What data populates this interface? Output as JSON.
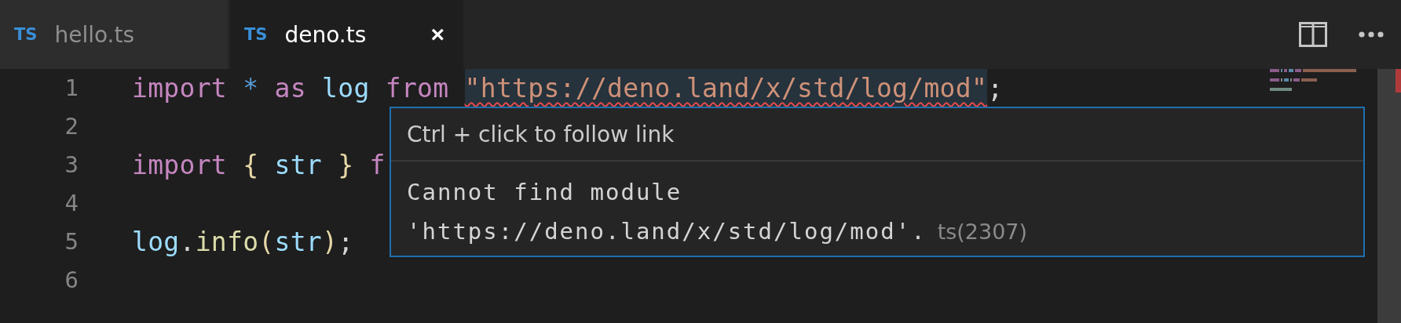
{
  "tabs": [
    {
      "icon": "TS",
      "label": "hello.ts",
      "selected": false
    },
    {
      "icon": "TS",
      "label": "deno.ts",
      "selected": true,
      "close": "×"
    }
  ],
  "editor": {
    "lines": [
      {
        "number": "1",
        "tokens": [
          {
            "kind": "keyword",
            "text": "import",
            "space": true
          },
          {
            "kind": "operator",
            "text": "*",
            "space": true
          },
          {
            "kind": "keyword",
            "text": "as",
            "space": true
          },
          {
            "kind": "variable",
            "text": "log",
            "space": true
          },
          {
            "kind": "keyword",
            "text": "from",
            "space": true
          },
          {
            "kind": "string",
            "text": "\"https://deno.land/x/std/log/mod\"",
            "highlighted": true,
            "error": true
          },
          {
            "kind": "punct",
            "text": ";"
          }
        ]
      },
      {
        "number": "2"
      },
      {
        "number": "3",
        "tokens": [
          {
            "kind": "keyword",
            "text": "import",
            "space": true
          },
          {
            "kind": "bracket",
            "text": "{",
            "space": true
          },
          {
            "kind": "variable",
            "text": "str",
            "space": true
          },
          {
            "kind": "bracket",
            "text": "}",
            "space": true
          },
          {
            "kind": "keyword",
            "text": "f"
          }
        ]
      },
      {
        "number": "4"
      },
      {
        "number": "5",
        "tokens": [
          {
            "kind": "variable",
            "text": "log"
          },
          {
            "kind": "punct",
            "text": "."
          },
          {
            "kind": "function",
            "text": "info"
          },
          {
            "kind": "bracket",
            "text": "("
          },
          {
            "kind": "variable",
            "text": "str"
          },
          {
            "kind": "bracket",
            "text": ")"
          },
          {
            "kind": "punct",
            "text": ";"
          }
        ]
      },
      {
        "number": "6"
      }
    ]
  },
  "hover": {
    "link_hint": "Ctrl + click to follow link",
    "message_lines": [
      "Cannot find module",
      "'https://deno.land/x/std/log/mod'."
    ],
    "code": "ts(2307)"
  }
}
